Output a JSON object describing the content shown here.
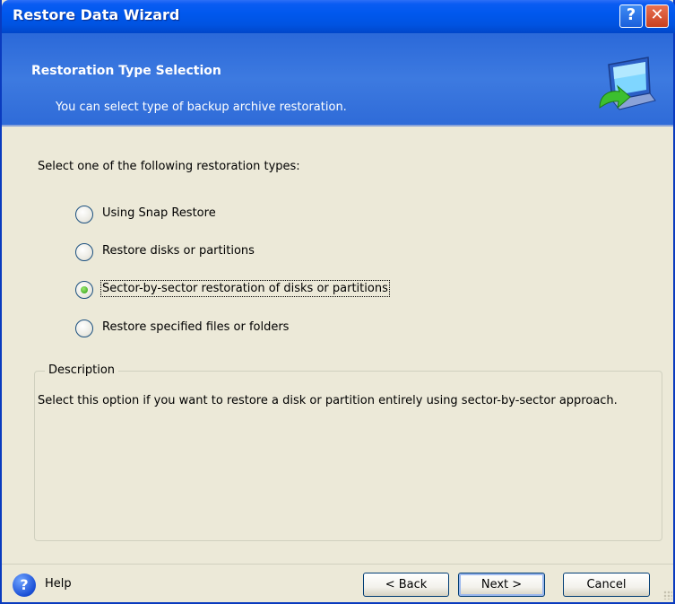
{
  "window": {
    "title": "Restore Data Wizard",
    "help_glyph": "?",
    "close_glyph": "✕"
  },
  "header": {
    "title": "Restoration Type Selection",
    "subtitle": "You can select type of backup archive restoration.",
    "icon": "computer-restore-icon"
  },
  "body": {
    "prompt": "Select one of the following restoration types:",
    "options": [
      {
        "label": "Using Snap Restore",
        "checked": false
      },
      {
        "label": "Restore disks or partitions",
        "checked": false
      },
      {
        "label": "Sector-by-sector restoration of disks or partitions",
        "checked": true
      },
      {
        "label": "Restore specified files or folders",
        "checked": false
      }
    ]
  },
  "description": {
    "legend": "Description",
    "text": "Select this option if you want to restore a disk or partition entirely using sector-by-sector approach."
  },
  "footer": {
    "help_glyph": "?",
    "help_label": "Help",
    "back_label": "< Back",
    "next_label": "Next >",
    "cancel_label": "Cancel"
  },
  "colors": {
    "titlebar": "#0058ee",
    "header": "#3d7ae0",
    "dialog_bg": "#ece9d8",
    "radio_selected": "#2d9e16",
    "close_button": "#c9401f"
  }
}
